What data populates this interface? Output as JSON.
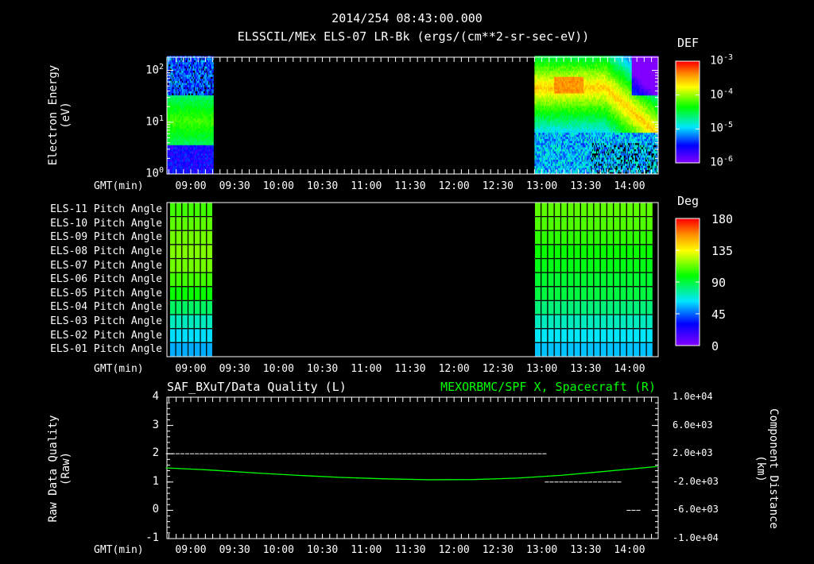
{
  "header": {
    "timestamp": "2014/254 08:43:00.000",
    "panel1_title": "ELSSCIL/MEx ELS-07 LR-Bk  (ergs/(cm**2-sr-sec-eV))"
  },
  "chart_data": [
    {
      "type": "heatmap",
      "title": "ELSSCIL/MEx ELS-07 LR-Bk  (ergs/(cm**2-sr-sec-eV))",
      "ylabel": [
        "Electron Energy",
        "(eV)"
      ],
      "xlabel": "GMT(min)",
      "x_ticks": [
        "09:00",
        "09:30",
        "10:00",
        "10:30",
        "11:00",
        "11:30",
        "12:00",
        "12:30",
        "13:00",
        "13:30",
        "14:00"
      ],
      "y_ticks": [
        "10",
        "10",
        "10"
      ],
      "y_tick_exps": [
        "0",
        "1",
        "2"
      ],
      "ylim_eV": [
        1,
        180
      ],
      "y_scale": "log",
      "colorbar": {
        "label": "DEF",
        "ticks": [
          "10",
          "10",
          "10",
          "10"
        ],
        "tick_exps": [
          "-3",
          "-4",
          "-5",
          "-6"
        ],
        "range": [
          1e-06,
          0.001
        ],
        "scale": "log"
      },
      "data_intervals_min_after_0843": [
        [
          0,
          32
        ],
        [
          252,
          336
        ]
      ],
      "description_bands": [
        {
          "interval": "08:43-09:15",
          "peak_energy_eV": [
            4,
            30
          ],
          "peak_log_def": -4.3
        },
        {
          "interval": "12:55-14:19",
          "peak_energy_eV": [
            30,
            90
          ],
          "peak_log_def": -3.5
        }
      ]
    },
    {
      "type": "heatmap",
      "xlabel": "GMT(min)",
      "rows": [
        "ELS-11 Pitch Angle",
        "ELS-10 Pitch Angle",
        "ELS-09 Pitch Angle",
        "ELS-08 Pitch Angle",
        "ELS-07 Pitch Angle",
        "ELS-06 Pitch Angle",
        "ELS-05 Pitch Angle",
        "ELS-04 Pitch Angle",
        "ELS-03 Pitch Angle",
        "ELS-02 Pitch Angle",
        "ELS-01 Pitch Angle"
      ],
      "x_ticks": [
        "09:00",
        "09:30",
        "10:00",
        "10:30",
        "11:00",
        "11:30",
        "12:00",
        "12:30",
        "13:00",
        "13:30",
        "14:00"
      ],
      "colorbar": {
        "label": "Deg",
        "ticks": [
          "180",
          "135",
          "90",
          "45",
          "0"
        ],
        "range": [
          0,
          180
        ]
      },
      "blocks": [
        {
          "interval": "08:47-09:15",
          "values_deg": [
            108,
            112,
            115,
            117,
            115,
            108,
            100,
            85,
            72,
            62,
            55
          ]
        },
        {
          "interval": "12:55-14:15",
          "values_deg": [
            112,
            110,
            105,
            100,
            96,
            92,
            90,
            82,
            72,
            64,
            58
          ]
        }
      ]
    },
    {
      "type": "line",
      "title_left": "SAF_BXuT/Data Quality (L)",
      "title_right": "MEXORBMC/SPF X, Spacecraft (R)",
      "ylabel_left": [
        "Raw Data Quality",
        "(Raw)"
      ],
      "ylabel_right": [
        "Component Distance",
        "(km)"
      ],
      "xlabel": "GMT(min)",
      "x_ticks": [
        "09:00",
        "09:30",
        "10:00",
        "10:30",
        "11:00",
        "11:30",
        "12:00",
        "12:30",
        "13:00",
        "13:30",
        "14:00"
      ],
      "ylim_left": [
        -1,
        4
      ],
      "y_ticks_left": [
        "4",
        "3",
        "2",
        "1",
        "0",
        "-1"
      ],
      "ylim_right": [
        -10000,
        10000
      ],
      "y_ticks_right": [
        "1.0e+04",
        "6.0e+03",
        "2.0e+03",
        "-2.0e+03",
        "-6.0e+03",
        "-1.0e+04"
      ],
      "series": [
        {
          "name": "Data Quality",
          "color": "#ffffff",
          "segments": [
            {
              "x_min": [
                0,
                259
              ],
              "y": 2
            },
            {
              "x_min": [
                259,
                310
              ],
              "y": 1
            },
            {
              "x_min": [
                315,
                322
              ],
              "y": 0
            }
          ]
        },
        {
          "name": "SPF X, Spacecraft",
          "color": "#00ff00",
          "x_min": [
            0,
            30,
            60,
            90,
            120,
            150,
            180,
            210,
            240,
            270,
            300,
            336
          ],
          "y_km": [
            0,
            -300,
            -700,
            -1050,
            -1350,
            -1550,
            -1680,
            -1650,
            -1450,
            -1050,
            -500,
            200
          ]
        }
      ]
    }
  ],
  "labels": {
    "gmt": "GMT(min)",
    "def": "DEF",
    "deg": "Deg"
  }
}
